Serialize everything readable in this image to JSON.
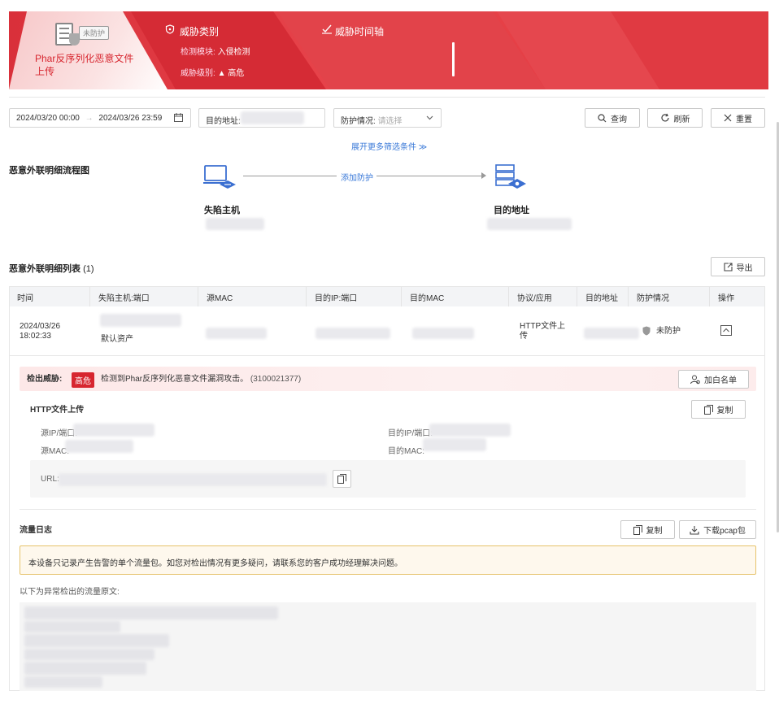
{
  "banner": {
    "title": "Phar反序列化恶意文件上传",
    "badge": "未防护",
    "category_label": "威胁类别",
    "module_label": "检测模块:",
    "module_value": "入侵检测",
    "level_label": "威胁级别:",
    "level_value": "高危",
    "timeline_label": "威胁时间轴"
  },
  "filters": {
    "date_start": "2024/03/20 00:00",
    "date_sep": "→",
    "date_end": "2024/03/26 23:59",
    "dest_label": "目的地址:",
    "protect_label": "防护情况:",
    "protect_placeholder": "请选择",
    "query": "查询",
    "refresh": "刷新",
    "reset": "重置",
    "expand": "展开更多筛选条件"
  },
  "flow": {
    "title": "恶意外联明细流程图",
    "left_label": "失陷主机",
    "link_label": "添加防护",
    "right_label": "目的地址"
  },
  "list": {
    "title": "恶意外联明细列表",
    "count": "(1)",
    "export": "导出",
    "columns": [
      "时间",
      "失陷主机:端口",
      "源MAC",
      "目的IP:端口",
      "目的MAC",
      "协议/应用",
      "目的地址",
      "防护情况",
      "操作"
    ],
    "rows": [
      {
        "time_date": "2024/03/26",
        "time_clock": "18:02:33",
        "host_asset": "默认资产",
        "protocol": "HTTP文件上传",
        "protect": "未防护"
      }
    ]
  },
  "detail": {
    "threat_label": "检出威胁:",
    "threat_tag": "高危",
    "threat_text": "检测到Phar反序列化恶意文件漏洞攻击。",
    "threat_id": "(3100021377)",
    "whitelist": "加白名单",
    "section": "HTTP文件上传",
    "copy": "复制",
    "src_ip": "源IP/端口:",
    "src_mac": "源MAC:",
    "dst_ip": "目的IP/端口:",
    "dst_mac": "目的MAC:",
    "url": "URL:"
  },
  "traffic": {
    "title": "流量日志",
    "copy": "复制",
    "download": "下载pcap包",
    "notice": "本设备只记录产生告警的单个流量包。如您对检出情况有更多疑问，请联系您的客户成功经理解决问题。",
    "raw_label": "以下为异常检出的流量原文:"
  },
  "colors": {
    "accent": "#d7262f",
    "link": "#3a79d8",
    "banner": "#e3383f"
  }
}
